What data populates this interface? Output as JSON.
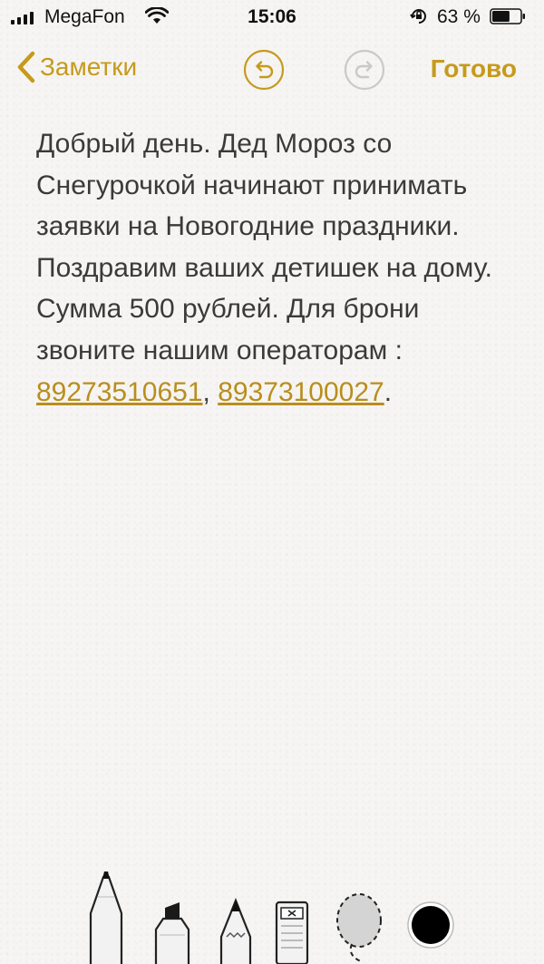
{
  "status_bar": {
    "carrier": "MegaFon",
    "time": "15:06",
    "battery_percent": "63 %",
    "battery_level": 0.63,
    "signal_bars": 4
  },
  "nav": {
    "back_label": "Заметки",
    "done_label": "Готово"
  },
  "note": {
    "text": "Добрый день. Дед Мороз со Снегурочкой начинают принимать заявки на Новогодние праздники. Поздравим ваших детишек на дому. Сумма 500 рублей. Для брони звоните нашим операторам : ",
    "phone_1": "89273510651",
    "separator": ", ",
    "phone_2": "89373100027",
    "end": "."
  },
  "colors": {
    "accent": "#c69a1c",
    "link": "#b98e1d",
    "text": "#3a3a3a",
    "background": "#f6f5f3"
  },
  "tools": {
    "items": [
      "pen-icon",
      "marker-icon",
      "pencil-icon",
      "eraser-icon",
      "lasso-icon",
      "color-picker-icon"
    ],
    "selected_color": "#000000"
  }
}
